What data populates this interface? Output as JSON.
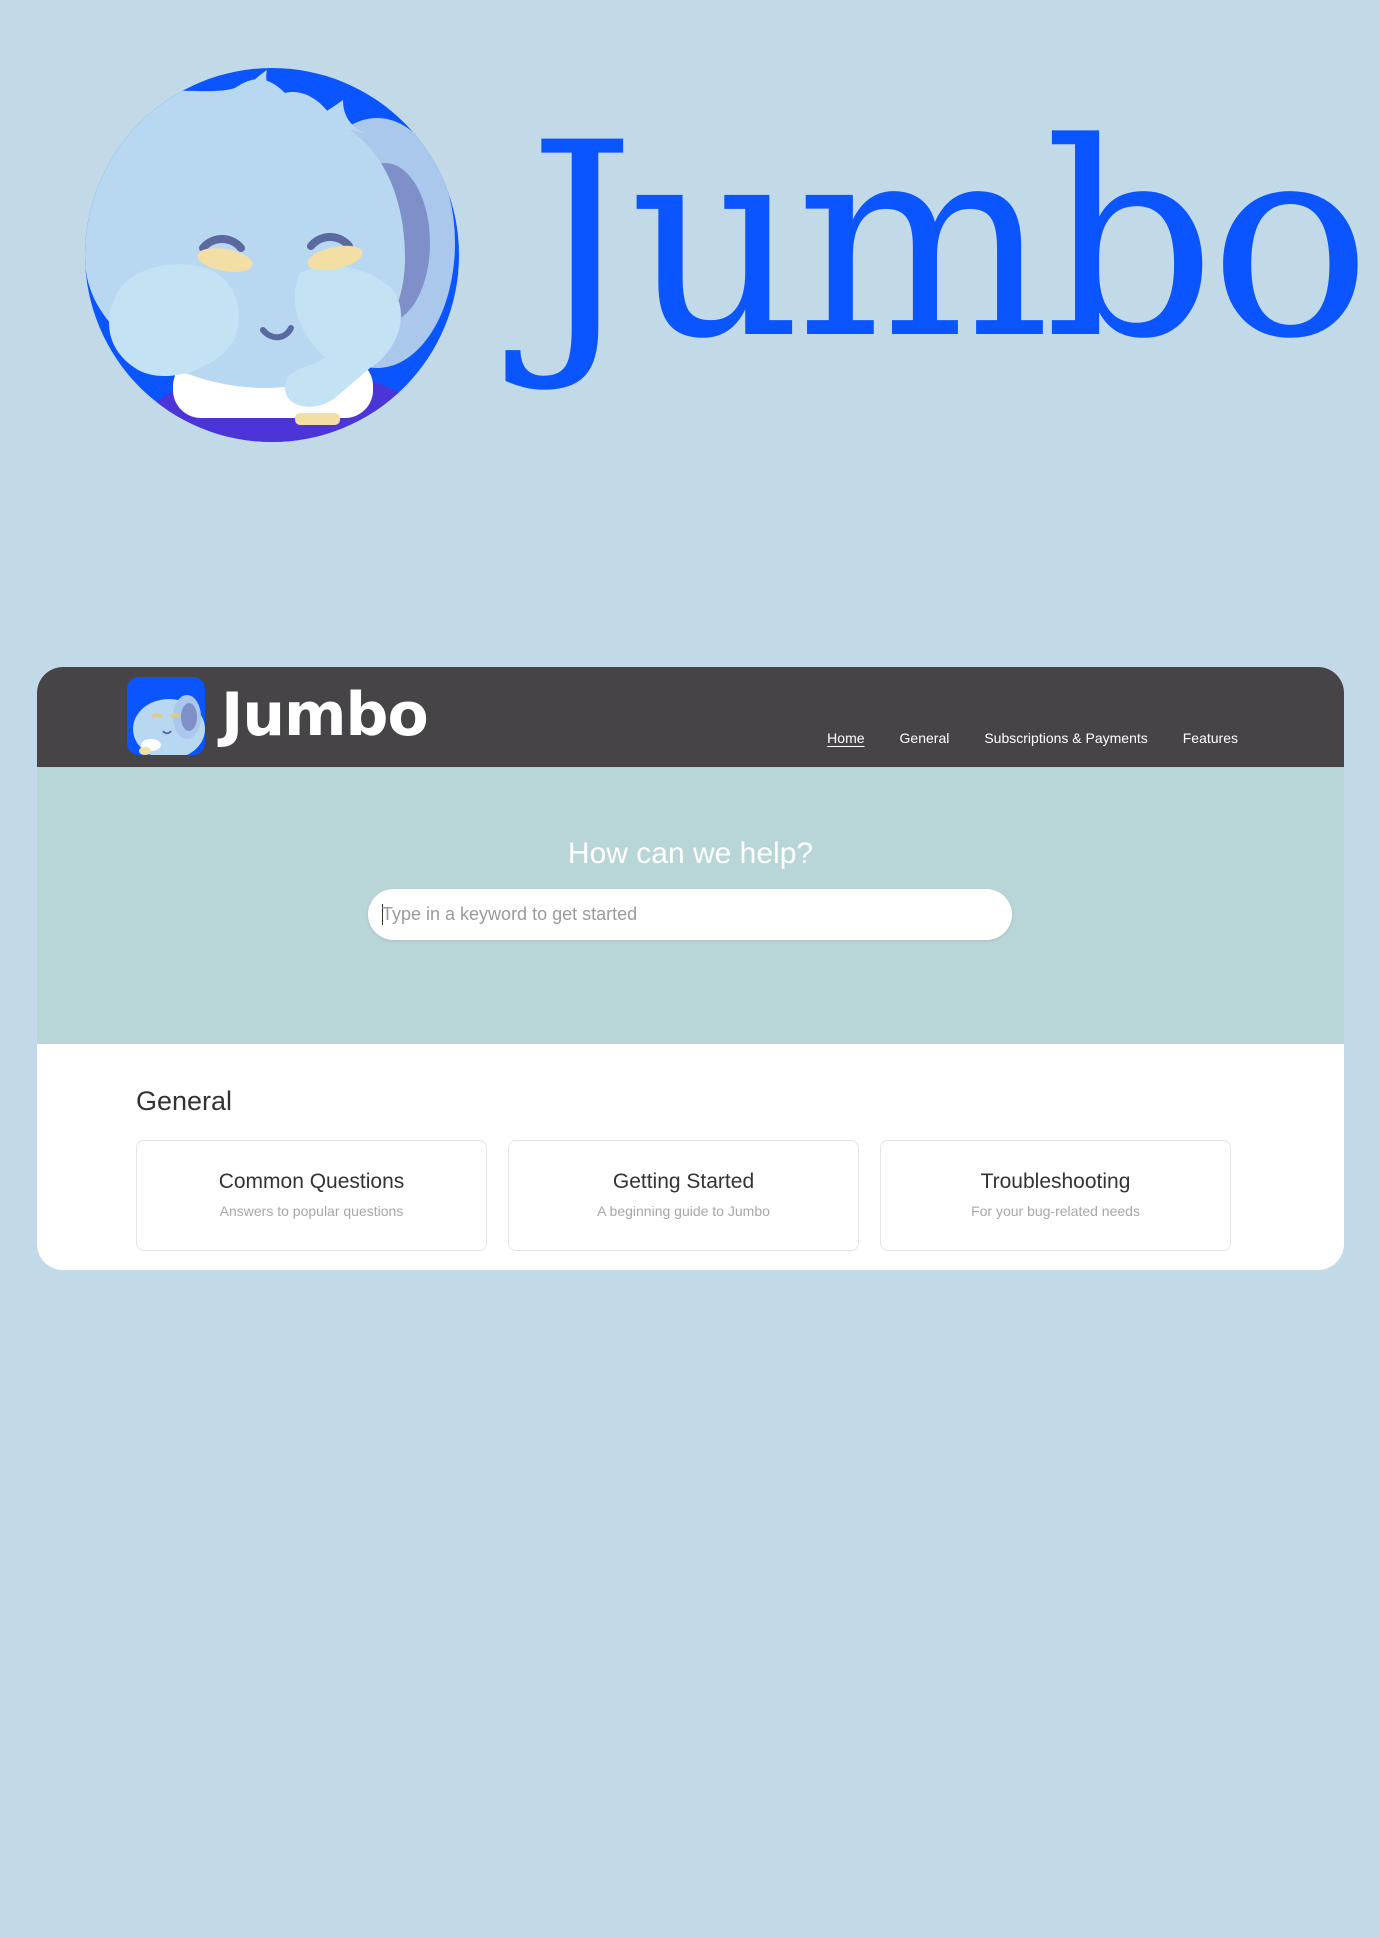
{
  "hero": {
    "wordmark": "Jumbo"
  },
  "header": {
    "brand_name": "Jumbo",
    "nav": [
      {
        "label": "Home",
        "active": true
      },
      {
        "label": "General",
        "active": false
      },
      {
        "label": "Subscriptions & Payments",
        "active": false
      },
      {
        "label": "Features",
        "active": false
      }
    ]
  },
  "search": {
    "title": "How can we help?",
    "placeholder": "Type in a keyword to get started",
    "value": ""
  },
  "general": {
    "heading": "General",
    "tiles": [
      {
        "title": "Common Questions",
        "subtitle": "Answers to popular questions"
      },
      {
        "title": "Getting Started",
        "subtitle": "A beginning guide to Jumbo"
      },
      {
        "title": "Troubleshooting",
        "subtitle": "For your bug-related needs"
      }
    ]
  },
  "colors": {
    "page_background": "#c2d9e8",
    "brand_blue": "#0a55ff",
    "topbar": "#474448",
    "search_band": "#b8d6d7"
  },
  "icons": {
    "hero_logo": "elephant-mascot-icon",
    "brand_icon": "elephant-mascot-icon"
  }
}
